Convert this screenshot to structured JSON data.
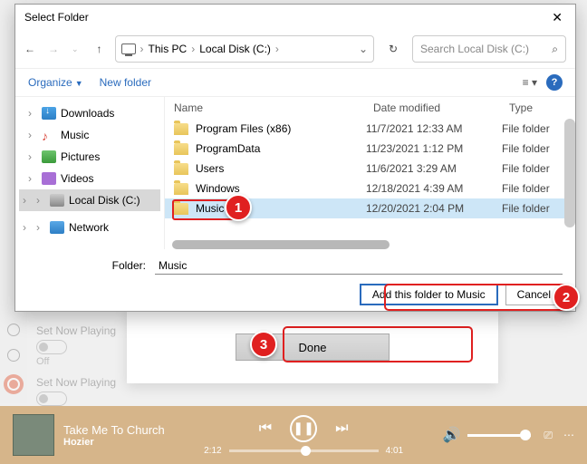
{
  "bgOptions": [
    {
      "label": "Set Now Playing",
      "state": "Off"
    },
    {
      "label": "Set Now Playing",
      "state": "Off"
    }
  ],
  "doneButton": "Done",
  "player": {
    "title": "Take Me To Church",
    "artist": "Hozier",
    "elapsed": "2:12",
    "total": "4:01"
  },
  "dialog": {
    "title": "Select Folder",
    "path": {
      "p1": "This PC",
      "p2": "Local Disk (C:)"
    },
    "searchPlaceholder": "Search Local Disk (C:)",
    "organize": "Organize",
    "newFolder": "New folder",
    "tree": [
      {
        "label": "Downloads",
        "icn": "ic-down",
        "exp": "›",
        "sel": false
      },
      {
        "label": "Music",
        "icn": "ic-music",
        "exp": "›",
        "sel": false
      },
      {
        "label": "Pictures",
        "icn": "ic-pic",
        "exp": "›",
        "sel": false
      },
      {
        "label": "Videos",
        "icn": "ic-vid",
        "exp": "›",
        "sel": false
      },
      {
        "label": "Local Disk (C:)",
        "icn": "ic-disk",
        "exp": "›",
        "sel": true,
        "extra": true
      },
      {
        "label": "Network",
        "icn": "ic-net",
        "exp": "›",
        "sel": false,
        "extra": true
      }
    ],
    "cols": {
      "c1": "Name",
      "c2": "Date modified",
      "c3": "Type"
    },
    "rows": [
      {
        "name": "Program Files (x86)",
        "date": "11/7/2021 12:33 AM",
        "type": "File folder",
        "sel": false
      },
      {
        "name": "ProgramData",
        "date": "11/23/2021 1:12 PM",
        "type": "File folder",
        "sel": false
      },
      {
        "name": "Users",
        "date": "11/6/2021 3:29 AM",
        "type": "File folder",
        "sel": false
      },
      {
        "name": "Windows",
        "date": "12/18/2021 4:39 AM",
        "type": "File folder",
        "sel": false
      },
      {
        "name": "Music",
        "date": "12/20/2021 2:04 PM",
        "type": "File folder",
        "sel": true
      }
    ],
    "folderLabel": "Folder:",
    "folderValue": "Music",
    "addBtn": "Add this folder to Music",
    "cancelBtn": "Cancel"
  },
  "callouts": [
    "1",
    "2",
    "3"
  ]
}
